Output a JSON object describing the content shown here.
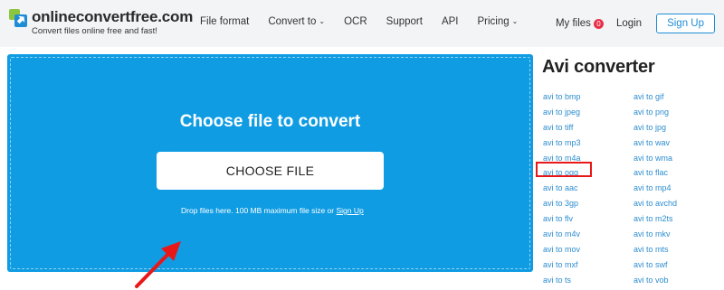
{
  "header": {
    "brand": "onlineconvertfree.com",
    "tagline": "Convert files online free and fast!",
    "nav": [
      {
        "label": "File format",
        "caret": false
      },
      {
        "label": "Convert to",
        "caret": true
      },
      {
        "label": "OCR",
        "caret": false
      },
      {
        "label": "Support",
        "caret": false
      },
      {
        "label": "API",
        "caret": false
      },
      {
        "label": "Pricing",
        "caret": true
      }
    ],
    "my_files": "My files",
    "my_files_count": "0",
    "login": "Login",
    "sign_up": "Sign Up"
  },
  "dropzone": {
    "title": "Choose file to convert",
    "button": "CHOOSE FILE",
    "note": "Drop files here. 100 MB maximum file size or",
    "note_link": "Sign Up"
  },
  "sidebar": {
    "title": "Avi converter",
    "col1": [
      "avi to bmp",
      "avi to jpeg",
      "avi to tiff",
      "avi to mp3",
      "avi to m4a",
      "avi to ogg",
      "avi to aac",
      "avi to 3gp",
      "avi to flv",
      "avi to m4v",
      "avi to mov",
      "avi to mxf",
      "avi to ts"
    ],
    "col2": [
      "avi to gif",
      "avi to png",
      "avi to jpg",
      "avi to wav",
      "avi to wma",
      "avi to flac",
      "avi to mp4",
      "avi to avchd",
      "avi to m2ts",
      "avi to mkv",
      "avi to mts",
      "avi to swf",
      "avi to vob"
    ],
    "highlighted": "avi to ogg"
  },
  "colors": {
    "accent": "#1f8dd6",
    "dropzone": "#0f9ce3",
    "badge": "#e8304a",
    "annotation": "#e81818"
  }
}
